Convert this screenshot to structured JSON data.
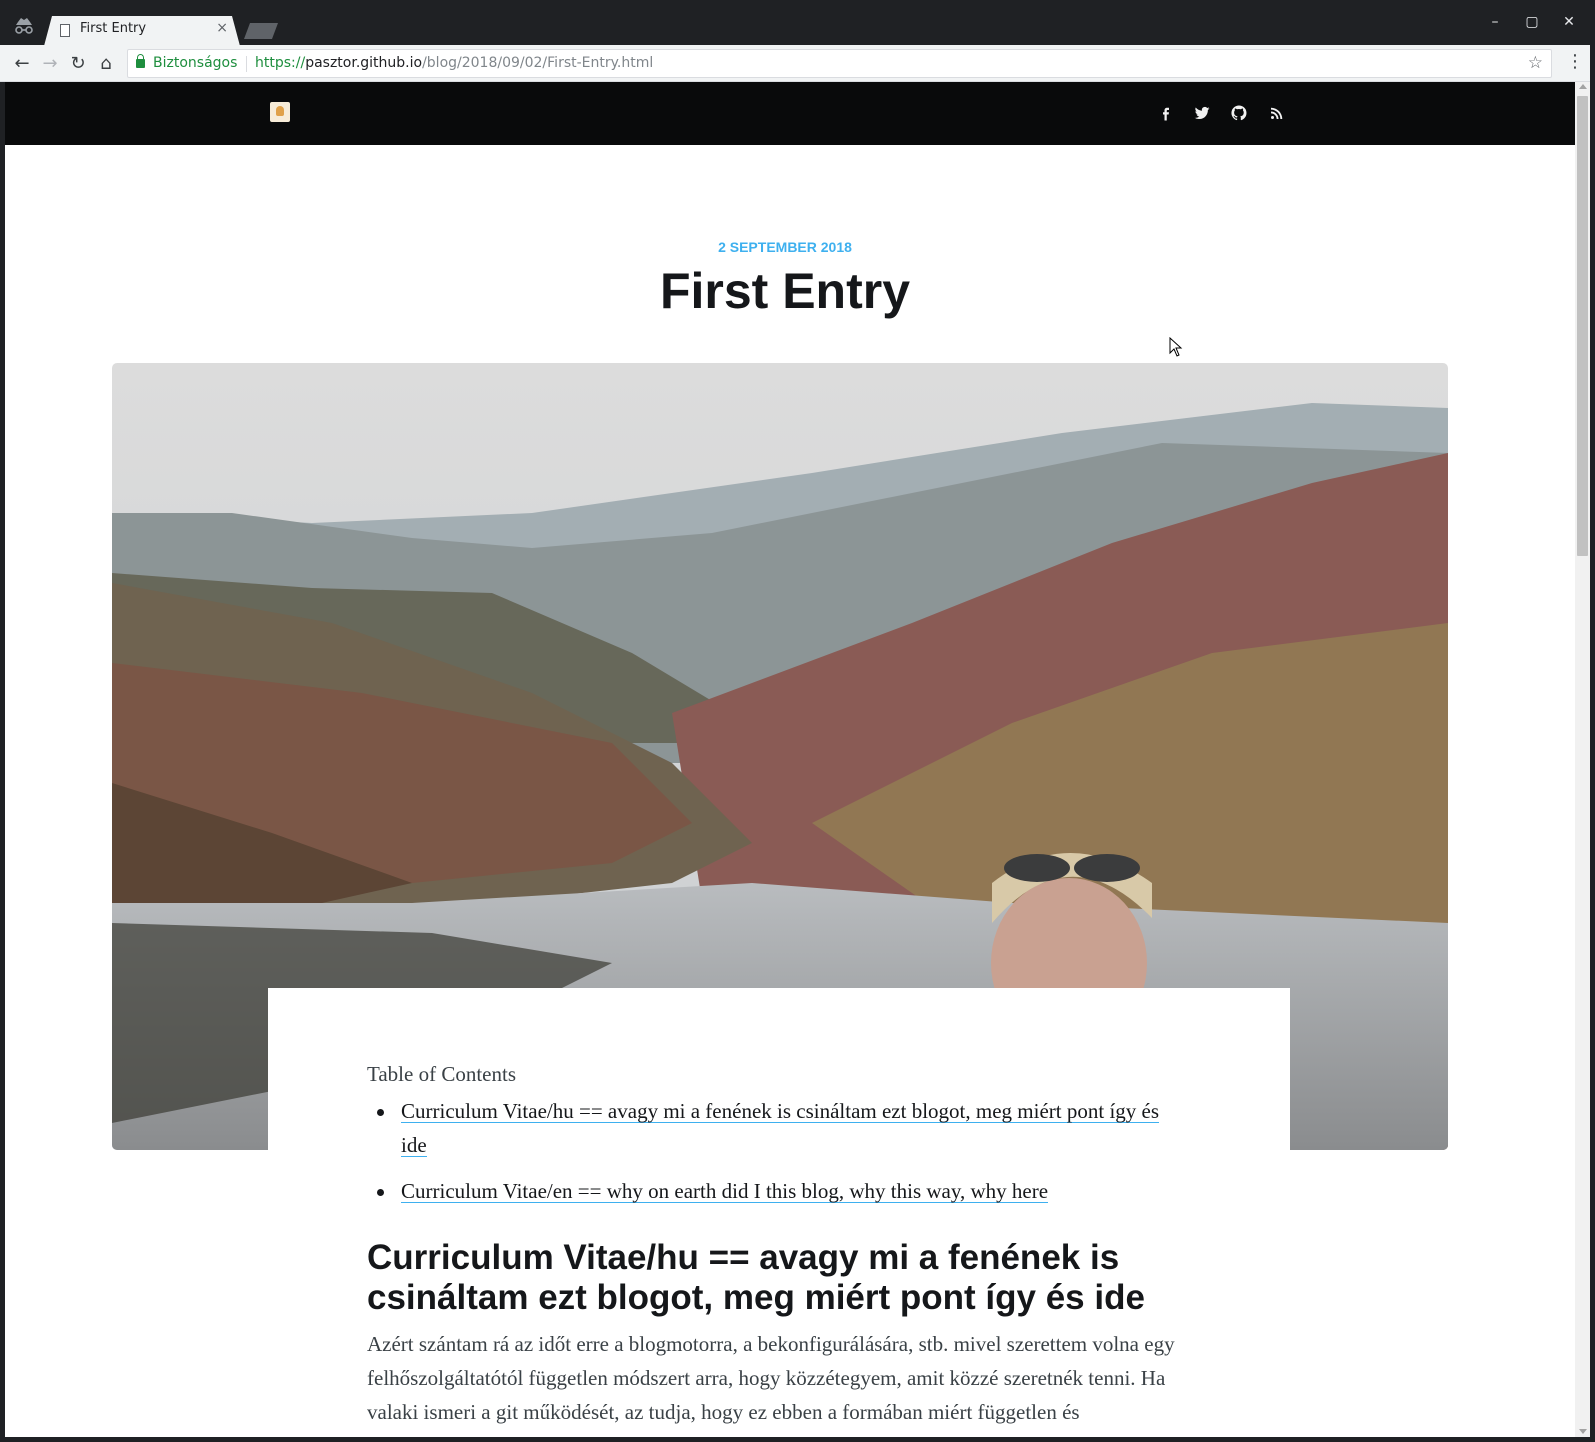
{
  "browser": {
    "tab_title": "First Entry",
    "tab_close": "×",
    "security_label": "Biztonságos",
    "url_scheme": "https://",
    "url_host": "pasztor.github.io",
    "url_path": "/blog/2018/09/02/First-Entry.html",
    "window_controls": {
      "minimize": "–",
      "maximize": "▢",
      "close": "✕"
    },
    "nav": {
      "back": "←",
      "forward": "→",
      "reload": "↻",
      "home": "⌂"
    },
    "bookmark_icon": "star-icon",
    "menu": "⋮"
  },
  "site": {
    "social_icons": [
      "facebook-icon",
      "twitter-icon",
      "github-icon",
      "rss-icon"
    ]
  },
  "post": {
    "date": "2 SEPTEMBER 2018",
    "title": "First Entry",
    "toc_title": "Table of Contents",
    "toc_items": [
      "Curriculum Vitae/hu == avagy mi a fenének is csináltam ezt blogot, meg miért pont így és ide",
      "Curriculum Vitae/en == why on earth did I this blog, why this way, why here"
    ],
    "section_heading": "Curriculum Vitae/hu == avagy mi a fenének is csináltam ezt blogot, meg miért pont így és ide",
    "paragraph": "Azért szántam rá az időt erre a blogmotorra, a bekonfigurálására, stb. mivel szerettem volna egy felhőszolgáltatótól független módszert arra, hogy közzétegyem, amit közzé szeretnék tenni. Ha valaki ismeri a git működését, az tudja, hogy ez ebben a formában miért független és"
  },
  "colors": {
    "accent": "#3eb0ef",
    "header_bg": "#090a0b",
    "secure_green": "#1e8e3e"
  }
}
